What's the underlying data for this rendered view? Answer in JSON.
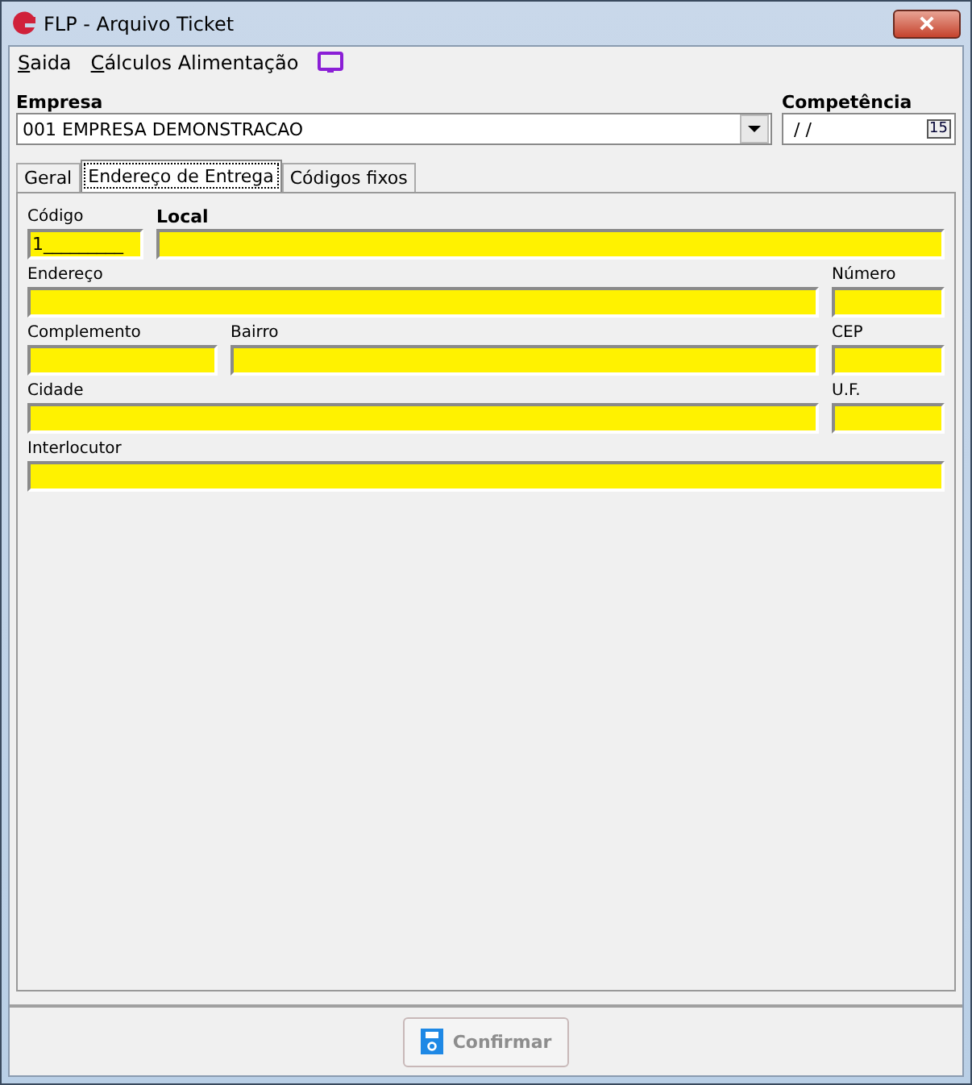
{
  "window": {
    "title": "FLP - Arquivo Ticket"
  },
  "menu": [
    {
      "label": "Saida"
    },
    {
      "label": "Cálculos Alimentação"
    }
  ],
  "empresa": {
    "label": "Empresa",
    "value": "001 EMPRESA DEMONSTRACAO"
  },
  "competencia": {
    "label": "Competência",
    "value": " / /",
    "calendar": "15"
  },
  "tabs": [
    {
      "label": "Geral",
      "selected": false
    },
    {
      "label": "Endereço de Entrega",
      "selected": true
    },
    {
      "label": "Códigos fixos",
      "selected": false
    }
  ],
  "rows": [
    [
      {
        "label": "Código",
        "bold": false,
        "value": "1_________"
      },
      {
        "label": "Local",
        "bold": true
      }
    ],
    [
      {
        "label": "Endereço",
        "bold": false
      },
      {
        "label": "Número",
        "bold": false
      }
    ],
    [
      {
        "label": "Complemento",
        "bold": false
      },
      {
        "label": "Bairro",
        "bold": false
      },
      {
        "label": "CEP",
        "bold": false
      }
    ],
    [
      {
        "label": "Cidade",
        "bold": false
      },
      {
        "label": "U.F.",
        "bold": false
      }
    ],
    [
      {
        "label": "Interlocutor",
        "bold": false
      }
    ]
  ],
  "confirm": {
    "label": "Confirmar",
    "disabled": true
  }
}
